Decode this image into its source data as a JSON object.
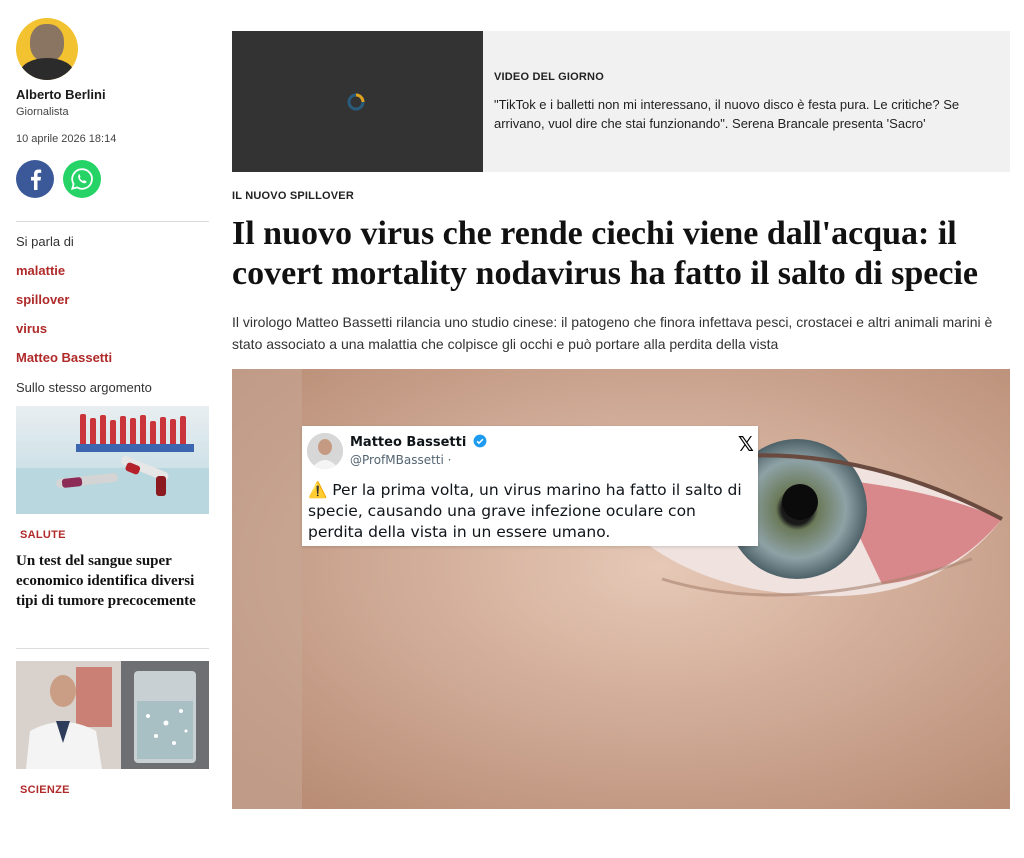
{
  "author": {
    "name": "Alberto Berlini",
    "role": "Giornalista",
    "date": "10 aprile 2026 18:14"
  },
  "share": {
    "facebook_icon": "facebook-icon",
    "whatsapp_icon": "whatsapp-icon"
  },
  "topics": {
    "label": "Si parla di",
    "items": [
      "malattie",
      "spillover",
      "virus",
      "Matteo Bassetti"
    ]
  },
  "related": {
    "label": "Sullo stesso argomento",
    "cards": [
      {
        "section": "SALUTE",
        "title": "Un test del sangue super economico identifica diversi tipi di tumore precocemente"
      },
      {
        "section": "SCIENZE",
        "title": ""
      }
    ]
  },
  "video": {
    "label": "VIDEO DEL GIORNO",
    "title": "\"TikTok e i balletti non mi interessano, il nuovo disco è festa pura. Le critiche? Se arrivano, vuol dire che stai funzionando\". Serena Brancale presenta 'Sacro'"
  },
  "article": {
    "kicker": "IL NUOVO SPILLOVER",
    "headline": "Il nuovo virus che rende ciechi viene dall'acqua: il covert mortality nodavirus ha fatto il salto di specie",
    "summary": "Il virologo Matteo Bassetti rilancia uno studio cinese: il patogeno che finora infettava pesci, crostacei e altri animali marini è stato associato a una malattia che colpisce gli occhi e può portare alla perdita della vista"
  },
  "tweet": {
    "name": "Matteo Bassetti",
    "handle": "@ProfMBassetti ·",
    "warning": "⚠️",
    "text": "Per la prima volta, un virus marino ha fatto il salto di specie, causando una grave infezione oculare con perdita della vista in un essere umano."
  },
  "colors": {
    "accent": "#b02a2a",
    "facebook": "#3b5998",
    "whatsapp": "#25d366",
    "verified": "#1d9bf0"
  }
}
